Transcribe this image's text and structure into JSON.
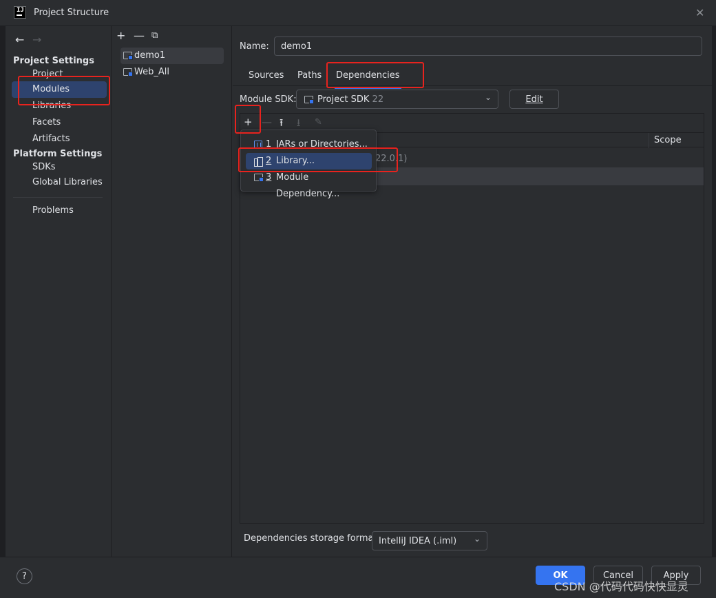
{
  "window": {
    "title": "Project Structure"
  },
  "nav": {
    "back": "←",
    "forward": "→",
    "project_settings_title": "Project Settings",
    "project_settings": [
      "Project",
      "Modules",
      "Libraries",
      "Facets",
      "Artifacts"
    ],
    "platform_settings_title": "Platform Settings",
    "platform_settings": [
      "SDKs",
      "Global Libraries"
    ],
    "problems": "Problems",
    "selected": "Modules"
  },
  "modules": {
    "toolbar": [
      "+",
      "—",
      "⧉"
    ],
    "items": [
      "demo1",
      "Web_All"
    ],
    "selected": "demo1"
  },
  "main": {
    "name_label": "Name:",
    "name_value": "demo1",
    "tabs": [
      "Sources",
      "Paths",
      "Dependencies"
    ],
    "active_tab": "Dependencies",
    "sdk_label": "Module SDK:",
    "sdk_value": "Project SDK",
    "sdk_version": "22",
    "edit_label": "Edit",
    "deps_toolbar": [
      "+",
      "—",
      "⭱",
      "⭳",
      "✎"
    ],
    "scope_header": "Scope",
    "row_partial": "22.0.1)",
    "storage_label": "Dependencies storage format:",
    "storage_value": "IntelliJ IDEA (.iml)"
  },
  "popup": {
    "items": [
      {
        "mnemonic": "1",
        "label": "JARs or Directories..."
      },
      {
        "mnemonic": "2",
        "label": "Library..."
      },
      {
        "mnemonic": "3",
        "label": "Module Dependency..."
      }
    ],
    "selected": "Library..."
  },
  "footer": {
    "help": "?",
    "ok": "OK",
    "cancel": "Cancel",
    "apply": "Apply"
  },
  "watermark": "CSDN @代码代码快快显灵",
  "colors": {
    "background": "#2b2d30",
    "selection": "#2e436e",
    "accent": "#3574f0",
    "annotation": "#e8231e"
  }
}
